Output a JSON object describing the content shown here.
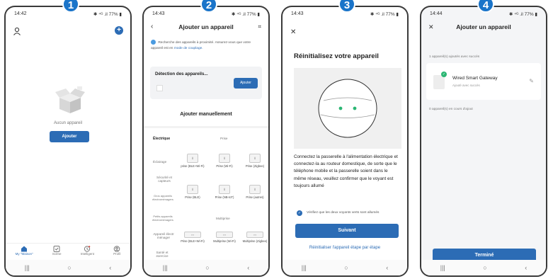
{
  "steps": [
    "1",
    "2",
    "3",
    "4"
  ],
  "screen1": {
    "time": "14:42",
    "status_right": "✱ ⁴ᴳ .il 77% ▮",
    "empty_text": "Aucun appareil",
    "add_button": "Ajouter",
    "tabs": [
      "My \"Maison\"",
      "Scène",
      "Intelligent",
      "Profil"
    ]
  },
  "screen2": {
    "time": "14:43",
    "status_right": "✱ ⁴ᴳ .il 77% ▮",
    "title": "Ajouter un appareil",
    "info_text": "Recherche des appareils à proximité. Assurez-vous que votre appareil est en",
    "info_link": "mode de couplage.",
    "detect_title": "Détection des appareils...",
    "detect_button": "Ajouter",
    "manual_title": "Ajouter manuellement",
    "categories": [
      "Électrique",
      "Éclairage",
      "Sécurité et capteurs",
      "Gros appareils électroménagers",
      "Petits appareils électroménagers",
      "Appareil électr ménager",
      "Santé et exercice"
    ],
    "sec_prise": "Prise",
    "sec_multi": "Multiprise",
    "row1": [
      "prise (BLE+Wi-Fi)",
      "Prise (Wi-Fi)",
      "Prise (Zigbee)"
    ],
    "row2": [
      "Prise (BLE)",
      "Prise (NB-IoT)",
      "Prise (autres)"
    ],
    "row3": [
      "Prise (BLE+Wi-Fi)",
      "Multiprise (Wi-Fi)",
      "Multiprise (Zigbee)"
    ]
  },
  "screen3": {
    "time": "14:43",
    "status_right": "✱ ⁴ᴳ .il 77% ▮",
    "title": "Réinitialisez votre appareil",
    "body": "Connectez la passerelle à l'alimentation électrique et connectez-la au routeur domestique, de sorte que le téléphone mobile et la passerelle soient dans le même réseau, veuillez confirmer que le voyant est toujours allumé",
    "check_text": "Vérifiez que les deux voyants verts sont allumés",
    "next_button": "Suivant",
    "step_link": "Réinitialiser l'appareil étape par étape"
  },
  "screen4": {
    "time": "14:44",
    "status_right": "✱ ⁴ᴳ .il 77% ▮",
    "title": "Ajouter un appareil",
    "added_count": "1 appareil(s) ajoutés avec succès",
    "device_name": "Wired Smart Gateway",
    "device_status": "Ajouté avec succès",
    "in_progress": "0 appareil(s) en cours d'ajout",
    "done_button": "Terminé"
  },
  "colors": {
    "accent": "#2c6cb5",
    "badge": "#1a74c9",
    "success": "#2bb673"
  }
}
